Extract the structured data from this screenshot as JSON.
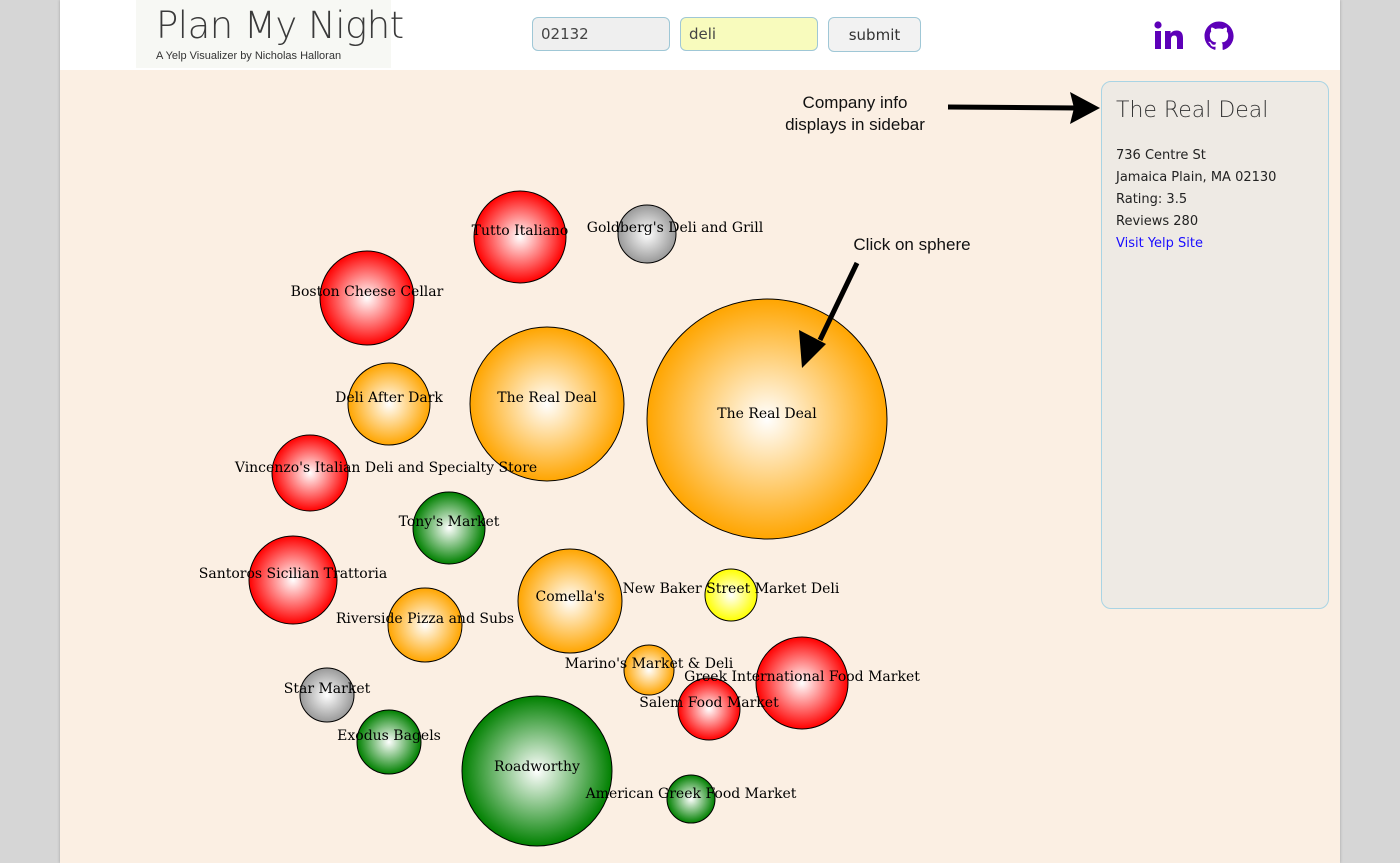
{
  "header": {
    "logo_title": "Plan My Night",
    "logo_subtitle": "A Yelp Visualizer by Nicholas Halloran",
    "zip_value": "02132",
    "term_value": "deli",
    "submit_label": "submit",
    "icons": [
      "linkedin-icon",
      "github-icon"
    ],
    "brand_color": "#5d00b8"
  },
  "annotations": {
    "sidebar_note_line1": "Company info",
    "sidebar_note_line2": "displays in sidebar",
    "click_note": "Click on sphere"
  },
  "sidebar": {
    "name": "The Real Deal",
    "address_line1": "736 Centre St",
    "address_line2": "Jamaica Plain, MA 02130",
    "rating": "Rating: 3.5",
    "reviews": "Reviews 280",
    "link": "Visit Yelp Site"
  },
  "colors": {
    "red": "#ff0000",
    "orange": "#ffa500",
    "green": "#008000",
    "gray": "#999999",
    "yellow": "#ffff00"
  },
  "bubbles": [
    {
      "name": "Tutto Italiano",
      "color": "red"
    },
    {
      "name": "Goldberg's Deli and Grill",
      "color": "gray"
    },
    {
      "name": "Boston Cheese Cellar",
      "color": "red"
    },
    {
      "name": "The Real Deal",
      "color": "orange"
    },
    {
      "name": "The Real Deal",
      "color": "orange"
    },
    {
      "name": "Deli After Dark",
      "color": "orange"
    },
    {
      "name": "Vincenzo's Italian Deli and Specialty Store",
      "color": "red"
    },
    {
      "name": "Tony's Market",
      "color": "green"
    },
    {
      "name": "Santoros Sicilian Trattoria",
      "color": "red"
    },
    {
      "name": "Comella's",
      "color": "orange"
    },
    {
      "name": "New Baker Street Market Deli",
      "color": "yellow"
    },
    {
      "name": "Riverside Pizza and Subs",
      "color": "orange"
    },
    {
      "name": "Star Market",
      "color": "gray"
    },
    {
      "name": "Marino's Market & Deli",
      "color": "orange"
    },
    {
      "name": "Greek International Food Market",
      "color": "red"
    },
    {
      "name": "Salem Food Market",
      "color": "red"
    },
    {
      "name": "Exodus Bagels",
      "color": "green"
    },
    {
      "name": "Roadworthy",
      "color": "green"
    },
    {
      "name": "American Greek Food Market",
      "color": "green"
    }
  ]
}
